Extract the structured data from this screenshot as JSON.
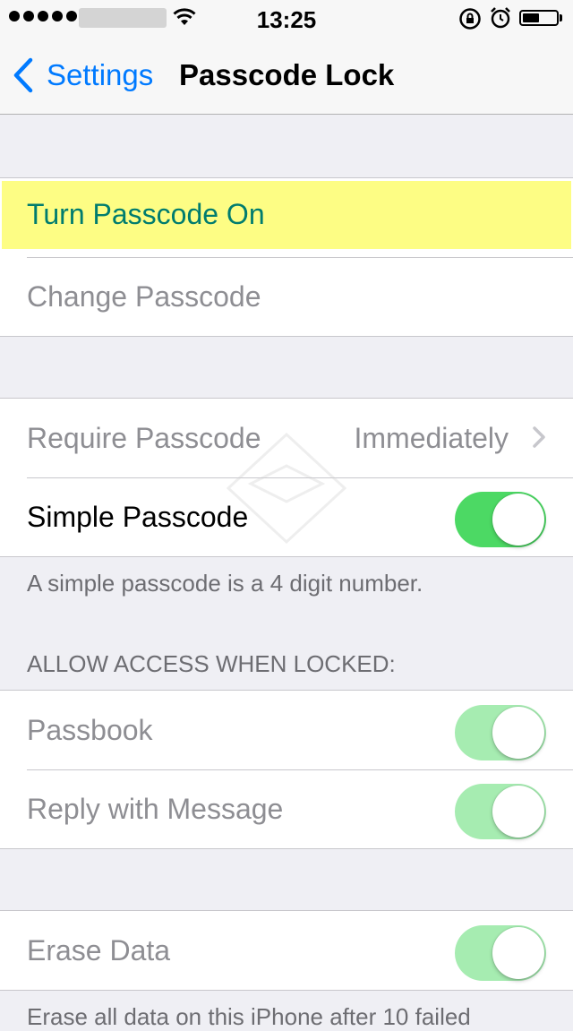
{
  "status_bar": {
    "time": "13:25"
  },
  "nav": {
    "back_label": "Settings",
    "title": "Passcode Lock"
  },
  "passcode_group": {
    "turn_on_label": "Turn Passcode On",
    "change_label": "Change Passcode"
  },
  "options_group": {
    "require_label": "Require Passcode",
    "require_value": "Immediately",
    "simple_label": "Simple Passcode",
    "simple_enabled": true,
    "simple_footer": "A simple passcode is a 4 digit number."
  },
  "allow_access": {
    "header": "ALLOW ACCESS WHEN LOCKED:",
    "items": [
      {
        "label": "Passbook",
        "enabled": true
      },
      {
        "label": "Reply with Message",
        "enabled": true
      }
    ]
  },
  "erase_group": {
    "erase_label": "Erase Data",
    "erase_enabled": true,
    "erase_footer": "Erase all data on this iPhone after 10 failed"
  },
  "colors": {
    "accent": "#007aff",
    "toggle_on": "#4cd964",
    "toggle_on_disabled": "#a6ecb1",
    "highlight": "#fdfd84",
    "highlight_text": "#007c6e",
    "disabled_text": "#8e8e93",
    "background": "#efeff4"
  }
}
